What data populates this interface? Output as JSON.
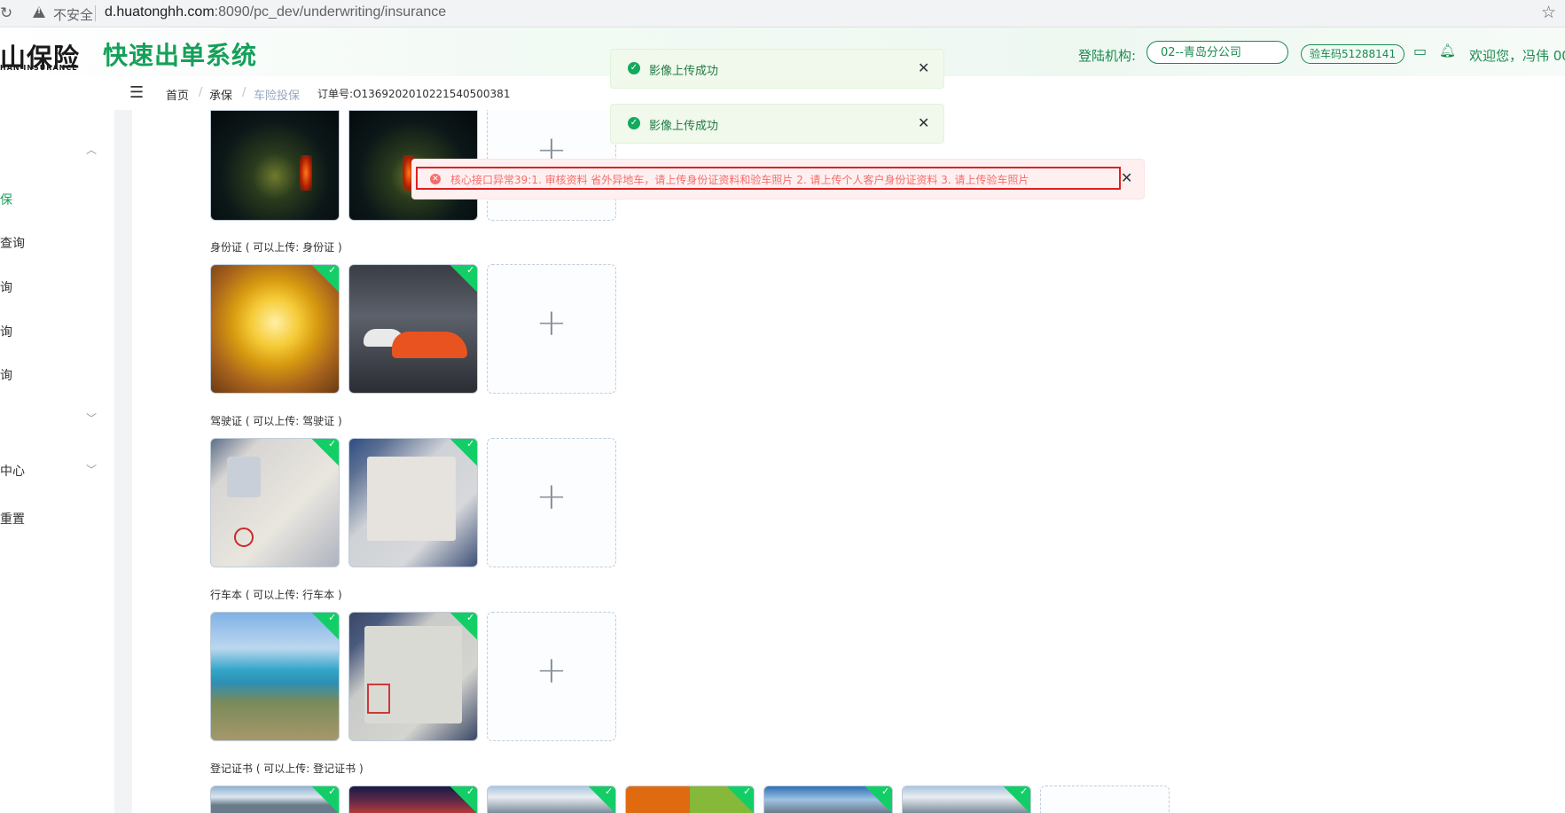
{
  "browser": {
    "security_label": "不安全",
    "url_host": "d.huatonghh.com",
    "url_rest": ":8090/pc_dev/underwriting/insurance",
    "reload_icon": "reload-icon",
    "star_icon": "bookmark-star-icon"
  },
  "header": {
    "logo_cn": "山保险",
    "logo_en": "HAN INSURANCE",
    "system_title": "快速出单系统",
    "login_label": "登陆机构:",
    "org_value": "02--青岛分公司",
    "verify_code": "验车码51288141",
    "welcome": "欢迎您，冯伟 00"
  },
  "breadcrumb": {
    "items": [
      "首页",
      "承保",
      "车险投保"
    ],
    "separator": "/",
    "order_no": "订单号:O1369202010221540500381"
  },
  "sidebar": {
    "items": [
      {
        "label": "保",
        "active": true
      },
      {
        "label": "查询"
      },
      {
        "label": "询"
      },
      {
        "label": "询"
      },
      {
        "label": "询"
      },
      {
        "label": "中心"
      },
      {
        "label": "重置"
      }
    ]
  },
  "sections": [
    {
      "label": "身份证 ( 可以上传: 身份证 )"
    },
    {
      "label": "驾驶证 ( 可以上传: 驾驶证 )"
    },
    {
      "label": "行车本 ( 可以上传: 行车本 )"
    },
    {
      "label": "登记证书 ( 可以上传: 登记证书 )"
    }
  ],
  "notifications": {
    "success_1": "影像上传成功",
    "success_2": "影像上传成功",
    "error": "核心接口异常39:1. 审核资料  省外异地车，请上传身份证资料和验车照片 2. 请上传个人客户身份证资料 3. 请上传验车照片"
  },
  "colors": {
    "brand_green": "#16a05a",
    "success_bg": "#f0f9eb",
    "error_text": "#f56c6c",
    "check_badge": "#13ce66"
  }
}
